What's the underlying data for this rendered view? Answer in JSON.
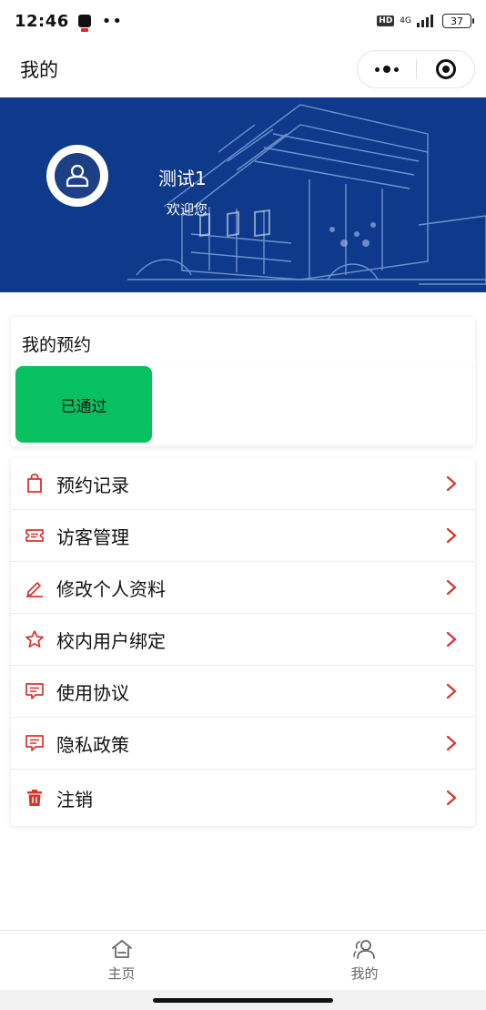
{
  "status_bar": {
    "time": "12:46",
    "dots": "••",
    "hd": "HD",
    "network": "4G",
    "battery": "37"
  },
  "nav": {
    "title": "我的"
  },
  "profile": {
    "username": "测试1",
    "welcome": "欢迎您"
  },
  "reservations": {
    "title": "我的预约",
    "status_label": "已通过"
  },
  "menu": {
    "items": [
      {
        "label": "预约记录",
        "icon": "shopping-bag-icon"
      },
      {
        "label": "访客管理",
        "icon": "ticket-icon"
      },
      {
        "label": "修改个人资料",
        "icon": "pencil-icon"
      },
      {
        "label": "校内用户绑定",
        "icon": "star-icon"
      },
      {
        "label": "使用协议",
        "icon": "message-icon"
      },
      {
        "label": "隐私政策",
        "icon": "message-icon"
      },
      {
        "label": "注销",
        "icon": "trash-icon"
      }
    ]
  },
  "tabbar": {
    "home": "主页",
    "mine": "我的"
  },
  "colors": {
    "banner": "#0f3a8c",
    "accent_red": "#d9342b",
    "passed_green": "#07c160"
  }
}
